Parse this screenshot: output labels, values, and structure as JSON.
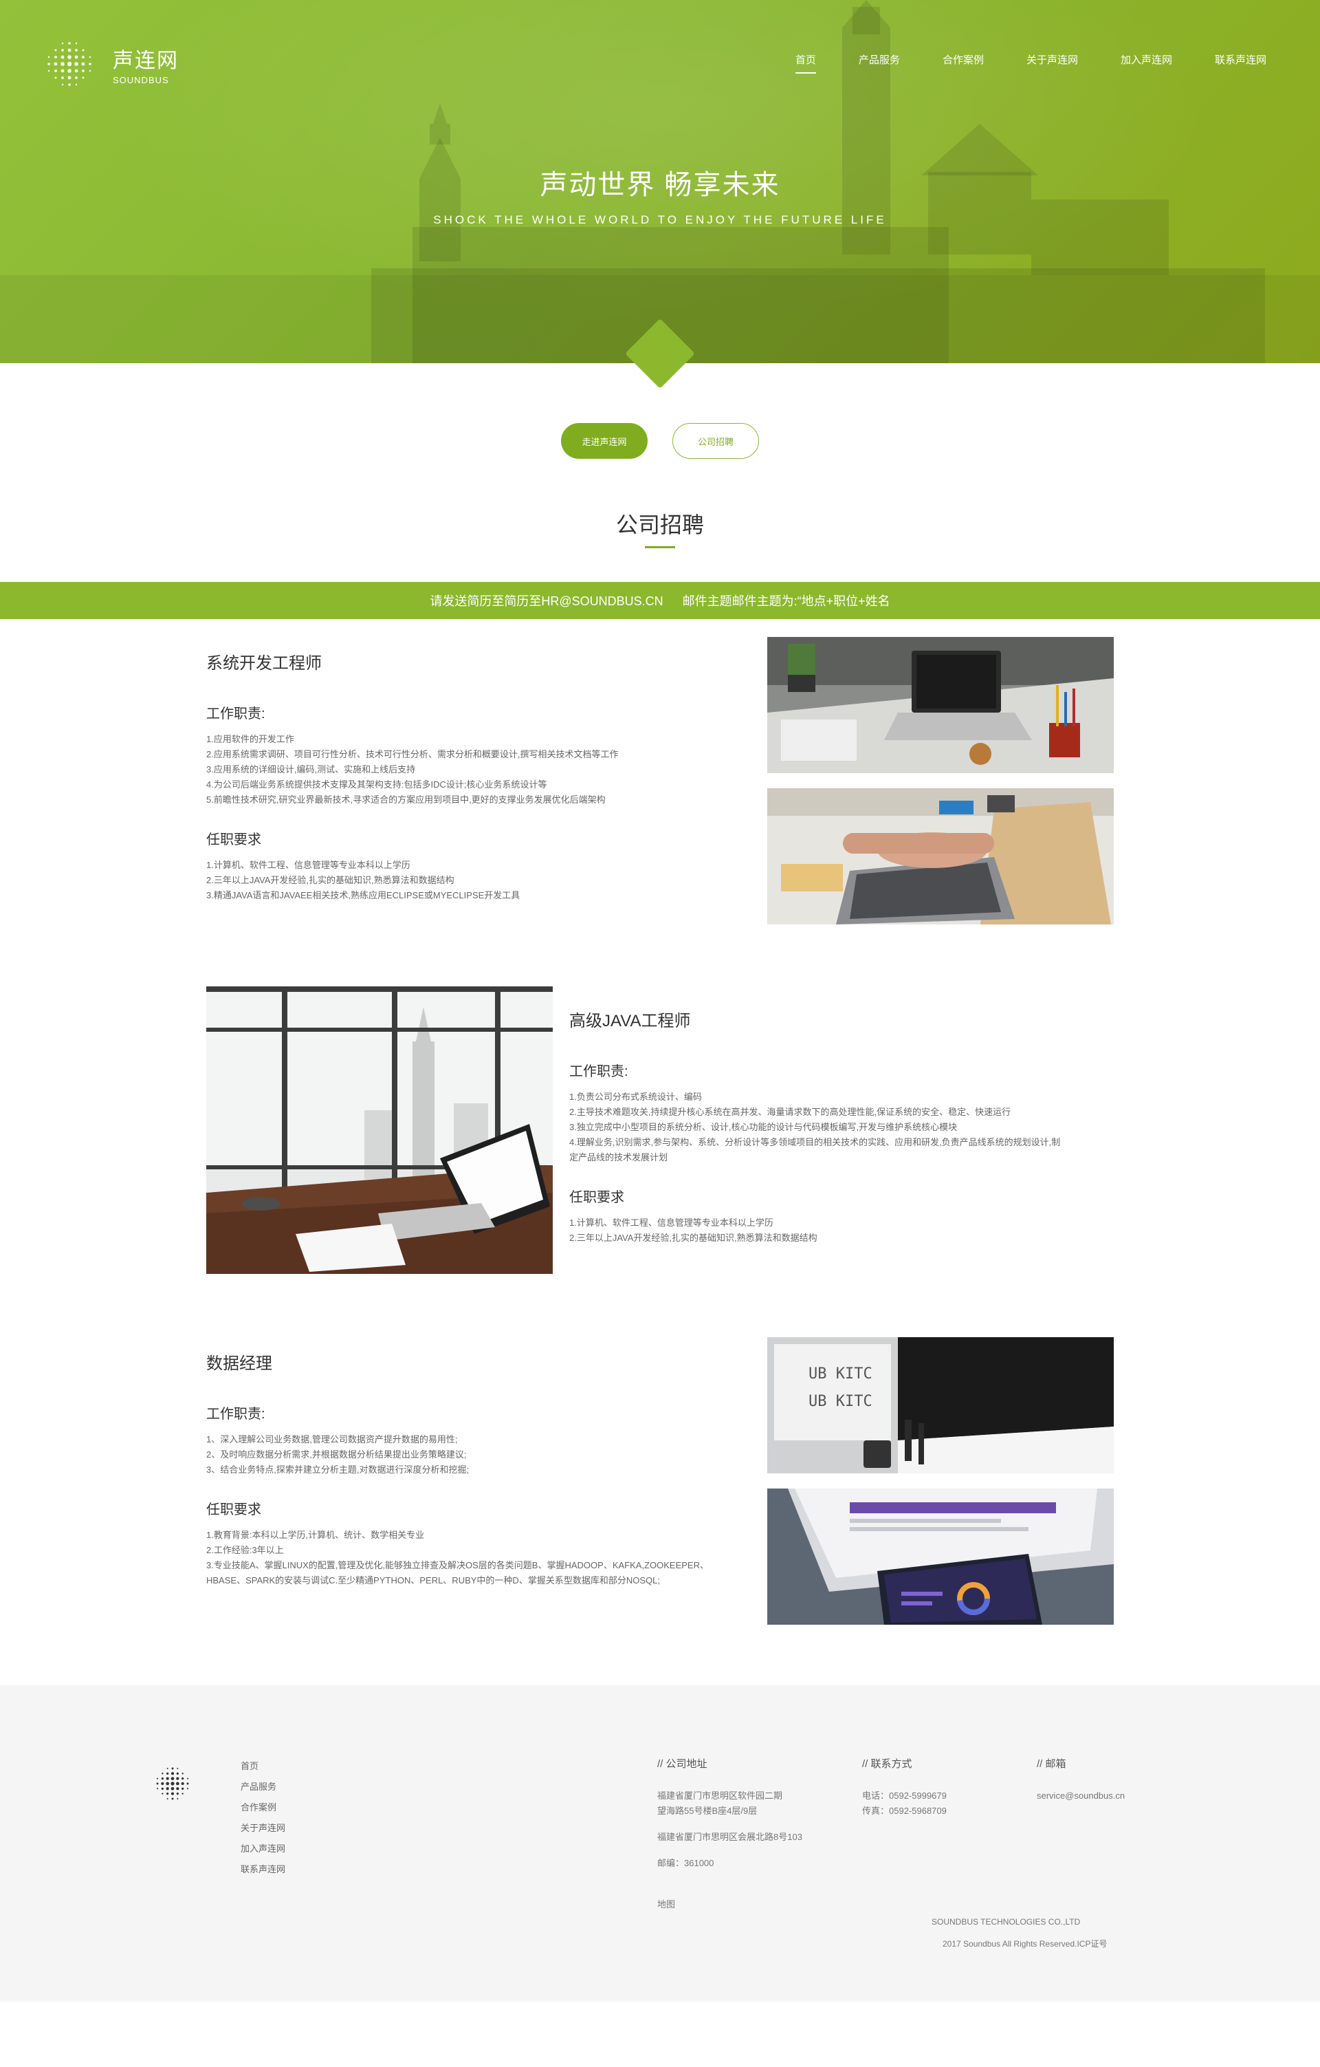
{
  "brand": {
    "name_cn": "声连网",
    "name_en": "SOUNDBUS"
  },
  "nav": [
    {
      "label": "首页",
      "active": true
    },
    {
      "label": "产品服务"
    },
    {
      "label": "合作案例"
    },
    {
      "label": "关于声连网"
    },
    {
      "label": "加入声连网"
    },
    {
      "label": "联系声连网"
    }
  ],
  "hero": {
    "title": "声动世界 畅享未来",
    "subtitle": "SHOCK THE WHOLE WORLD TO  ENJOY THE FUTURE LIFE"
  },
  "tabs": [
    {
      "label": "走进声连网"
    },
    {
      "label": "公司招聘"
    }
  ],
  "section_title": "公司招聘",
  "notice": {
    "email": "请发送简历至简历至HR@SOUNDBUS.CN",
    "subject": "邮件主题邮件主题为:“地点+职位+姓名"
  },
  "jobs": [
    {
      "title": "系统开发工程师",
      "duty_label": "工作职责:",
      "duties": [
        "1.应用软件的开发工作",
        "2.应用系统需求调研、项目可行性分析、技术可行性分析、需求分析和概要设计,撰写相关技术文档等工作",
        "3.应用系统的详细设计,编码,测试、实施和上线后支持",
        "4.为公司后端业务系统提供技术支撑及其架构支持:包括多IDC设计;核心业务系统设计等",
        "5.前瞻性技术研究,研究业界最新技术,寻求适合的方案应用到项目中,更好的支撑业务发展优化后端架构"
      ],
      "req_label": "任职要求",
      "reqs": [
        "1.计算机、软件工程、信息管理等专业本科以上学历",
        "2.三年以上JAVA开发经验,扎实的基础知识,熟悉算法和数据结构",
        "3.精通JAVA语言和JAVAEE相关技术,熟练应用ECLIPSE或MYECLIPSE开发工具"
      ]
    },
    {
      "title": "高级JAVA工程师",
      "duty_label": "工作职责:",
      "duties": [
        "1.负责公司分布式系统设计、编码",
        "2.主导技术难题攻关,持续提升核心系统在高并发、海量请求数下的高处理性能,保证系统的安全、稳定、快速运行",
        "3.独立完成中小型项目的系统分析、设计,核心功能的设计与代码模板编写,开发与维护系统核心模块",
        "4.理解业务,识别需求,参与架构、系统、分析设计等多领域项目的相关技术的实践、应用和研发,负责产品线系统的规划设计,制",
        "定产品线的技术发展计划"
      ],
      "req_label": "任职要求",
      "reqs": [
        "1.计算机、软件工程、信息管理等专业本科以上学历",
        "2.三年以上JAVA开发经验,扎实的基础知识,熟悉算法和数据结构"
      ]
    },
    {
      "title": "数据经理",
      "duty_label": "工作职责:",
      "duties": [
        "1、深入理解公司业务数据,管理公司数据资产提升数据的易用性;",
        "2、及时响应数据分析需求,并根据数据分析结果提出业务策略建议;",
        "3、结合业务特点,探索并建立分析主题,对数据进行深度分析和挖掘;"
      ],
      "req_label": "任职要求",
      "reqs": [
        "1.教育背景:本科以上学历,计算机、统计、数学相关专业",
        "2.工作经验:3年以上",
        "3.专业技能A、掌握LINUX的配置,管理及优化,能够独立排查及解决OS层的各类问题B、掌握HADOOP、KAFKA,ZOOKEEPER、",
        "HBASE、SPARK的安装与调试C.至少精通PYTHON、PERL、RUBY中的一种D、掌握关系型数据库和部分NOSQL;"
      ]
    }
  ],
  "footer": {
    "nav": [
      "首页",
      "产品服务",
      "合作案例",
      "关于声连网",
      "加入声连网",
      "联系声连网"
    ],
    "address": {
      "heading": "// 公司地址",
      "line1": "福建省厦门市思明区软件园二期",
      "line2": "望海路55号楼B座4层/9层",
      "line3": "福建省厦门市思明区会展北路8号103",
      "postcode": "邮编：361000",
      "map": "地图"
    },
    "contact": {
      "heading": "// 联系方式",
      "phone": "电话：0592-5999679",
      "fax": "传真：0592-5968709"
    },
    "mail": {
      "heading": "// 邮箱",
      "email": "service@soundbus.cn"
    },
    "company": "SOUNDBUS TECHNOLOGIES CO.,LTD",
    "copyright": "2017 Soundbus All Rights Reserved.ICP证号"
  },
  "colors": {
    "accent": "#8cb82e",
    "accent_dark": "#7fad1f",
    "footer_bg": "#f5f5f5"
  }
}
